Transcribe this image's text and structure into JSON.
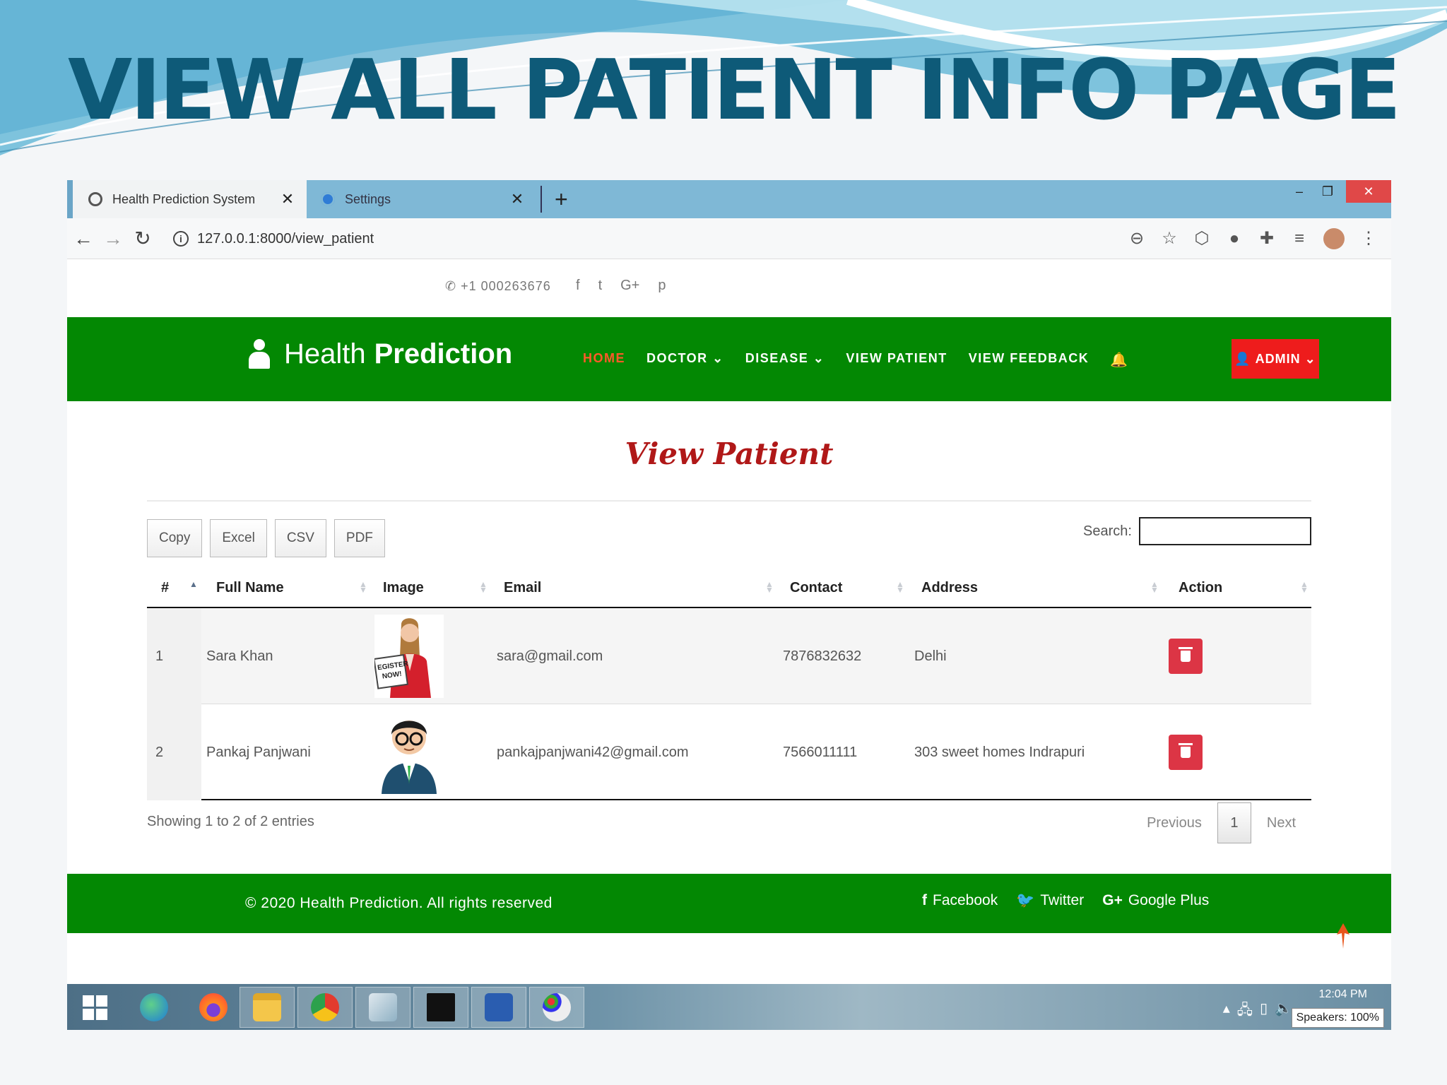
{
  "slide": {
    "title": "VIEW ALL PATIENT INFO PAGE"
  },
  "browser": {
    "tabs": [
      {
        "label": "Health Prediction System",
        "active": true
      },
      {
        "label": "Settings",
        "active": false
      }
    ],
    "url": "127.0.0.1:8000/view_patient"
  },
  "topbar": {
    "phone": "+1 000263676",
    "socials": [
      "f",
      "t",
      "G+",
      "p"
    ]
  },
  "navbar": {
    "brand_light": "Health",
    "brand_bold": "Prediction",
    "links": [
      "HOME",
      "DOCTOR ⌄",
      "DISEASE ⌄",
      "VIEW PATIENT",
      "VIEW FEEDBACK"
    ],
    "admin_label": "ADMIN ⌄"
  },
  "page": {
    "heading": "View Patient"
  },
  "table": {
    "export_buttons": [
      "Copy",
      "Excel",
      "CSV",
      "PDF"
    ],
    "search_label": "Search:",
    "columns": [
      "#",
      "Full Name",
      "Image",
      "Email",
      "Contact",
      "Address",
      "Action"
    ],
    "rows": [
      {
        "id": "1",
        "name": "Sara Khan",
        "email": "sara@gmail.com",
        "contact": "7876832632",
        "address": "Delhi"
      },
      {
        "id": "2",
        "name": "Pankaj Panjwani",
        "email": "pankajpanjwani42@gmail.com",
        "contact": "7566011111",
        "address": "303 sweet homes Indrapuri"
      }
    ],
    "thumb_text": [
      "EGISTER",
      "NOW!"
    ],
    "info": "Showing 1 to 2 of 2 entries",
    "pager": {
      "prev": "Previous",
      "page": "1",
      "next": "Next"
    }
  },
  "footer": {
    "copyright": "© 2020 Health Prediction. All rights reserved",
    "links": [
      "Facebook",
      "Twitter",
      "Google Plus"
    ]
  },
  "taskbar": {
    "clock": "12:04 PM",
    "tooltip": "Speakers: 100%"
  },
  "colors": {
    "navbar": "#038803",
    "admin": "#ee1c1c",
    "heading": "#b01818",
    "title": "#0e5a78",
    "delete": "#dc3545"
  }
}
